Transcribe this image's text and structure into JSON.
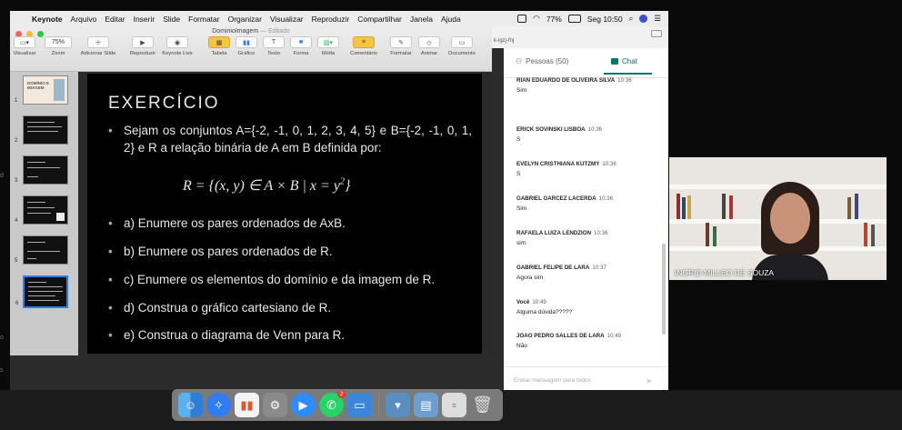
{
  "menubar": {
    "app": "Keynote",
    "items": [
      "Arquivo",
      "Editar",
      "Inserir",
      "Slide",
      "Formatar",
      "Organizar",
      "Visualizar",
      "Reproduzir",
      "Compartilhar",
      "Janela",
      "Ajuda"
    ],
    "battery": "77%",
    "clock": "Seg 10:50"
  },
  "keynote": {
    "doc_title": "DominioImagem",
    "doc_status": "— Editado",
    "zoom": "75%",
    "toolbar": [
      "Visualizar",
      "Zoom",
      "Adicionar Slide",
      "Reproduzir",
      "Keynote Live",
      "Tabela",
      "Gráfico",
      "Texto",
      "Forma",
      "Mídia",
      "Comentário",
      "Formatar",
      "Animar",
      "Documento"
    ],
    "thumb_numbers": [
      "1",
      "2",
      "3",
      "4",
      "5",
      "6"
    ],
    "thumb1_text": "DOMÍNIO E IMAGEM"
  },
  "slide": {
    "title": "EXERCÍCIO",
    "intro": "Sejam os conjuntos A={-2, -1, 0, 1, 2, 3, 4, 5} e B={-2, -1, 0, 1, 2} e R a relação binária de A em B definida por:",
    "formula_main": "R = {(x, y) ∈ A × B | x = y",
    "formula_exp": "2",
    "formula_end": "}",
    "items": [
      "a) Enumere os pares ordenados de AxB.",
      "b) Enumere os pares ordenados de R.",
      "c) Enumere os elementos do domínio e da imagem de R.",
      "d) Construa o gráfico cartesiano de R.",
      "e) Construa o diagrama de Venn para R."
    ]
  },
  "meet": {
    "url_fragment": "k-igzj-fnj",
    "people_tab": "Pessoas (50)",
    "chat_tab": "Chat",
    "messages": [
      {
        "sender": "RIAN EDUARDO DE OLIVEIRA SILVA",
        "time": "10:36",
        "text": "Sim"
      },
      {
        "sender": "ERICK SOVINSKI LISBOA",
        "time": "10:36",
        "text": "S"
      },
      {
        "sender": "EVELYN CRISTHIANA KUTZMY",
        "time": "10:36",
        "text": "S"
      },
      {
        "sender": "GABRIEL GARCEZ LACERDA",
        "time": "10:36",
        "text": "Sim"
      },
      {
        "sender": "RAFAELA LUIZA LENDZION",
        "time": "10:36",
        "text": "sim"
      },
      {
        "sender": "GABRIEL FELIPE DE LARA",
        "time": "10:37",
        "text": "Agora sim"
      },
      {
        "sender": "Você",
        "time": "10:49",
        "text": "Alguma dúvida?????"
      },
      {
        "sender": "JOAO PEDRO SALLES DE LARA",
        "time": "10:49",
        "text": "Não"
      }
    ],
    "input_placeholder": "Enviar mensagem para todos"
  },
  "video": {
    "participant": "INGRID MILLEO DE SOUZA"
  },
  "dock": {
    "badge_count": "2"
  },
  "colors": {
    "meet_accent": "#00796b",
    "selection": "#2f7cf6",
    "badge": "#e53935"
  }
}
